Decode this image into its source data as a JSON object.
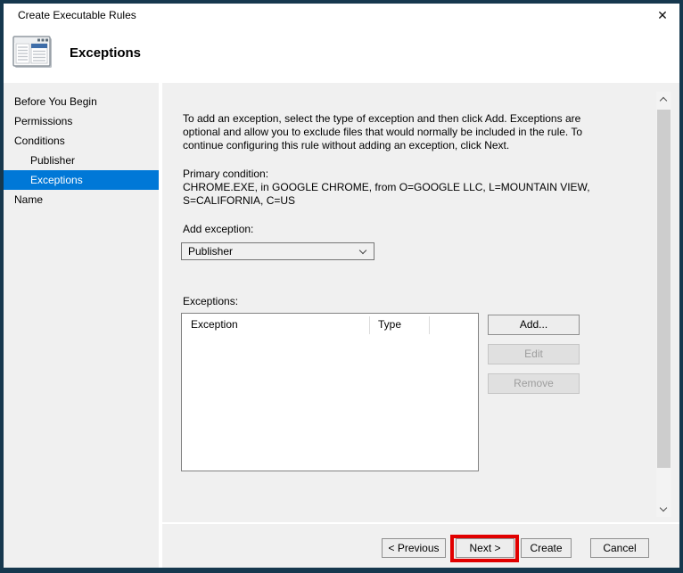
{
  "window": {
    "title": "Create Executable Rules"
  },
  "icons": {
    "close": "✕"
  },
  "header": {
    "title": "Exceptions"
  },
  "sidebar": {
    "items": [
      {
        "label": "Before You Begin",
        "indent": false,
        "selected": false
      },
      {
        "label": "Permissions",
        "indent": false,
        "selected": false
      },
      {
        "label": "Conditions",
        "indent": false,
        "selected": false
      },
      {
        "label": "Publisher",
        "indent": true,
        "selected": false
      },
      {
        "label": "Exceptions",
        "indent": true,
        "selected": true
      },
      {
        "label": "Name",
        "indent": false,
        "selected": false
      }
    ]
  },
  "main": {
    "intro": "To add an exception, select the type of exception and then click Add. Exceptions are\noptional and allow you to exclude files that would normally be included in the rule. To\ncontinue configuring this rule without adding an exception, click Next.",
    "primary_condition_label": "Primary condition:",
    "primary_condition_value": "CHROME.EXE, in GOOGLE CHROME, from O=GOOGLE LLC, L=MOUNTAIN VIEW,\nS=CALIFORNIA, C=US",
    "add_exception_label": "Add exception:",
    "dropdown": {
      "value": "Publisher"
    },
    "exceptions_label": "Exceptions:",
    "table": {
      "columns": [
        "Exception",
        "Type"
      ],
      "rows": []
    },
    "buttons": {
      "add": "Add...",
      "edit": "Edit",
      "remove": "Remove"
    }
  },
  "footer": {
    "previous": "< Previous",
    "next": "Next >",
    "create": "Create",
    "cancel": "Cancel"
  },
  "annotations": {
    "highlighted_button": "Next >"
  },
  "colors": {
    "window-border": "#16384e",
    "selection": "#0078d7",
    "red": "#e10000",
    "panel": "#f0f0f0",
    "icon-blue": "#3e6da8"
  }
}
